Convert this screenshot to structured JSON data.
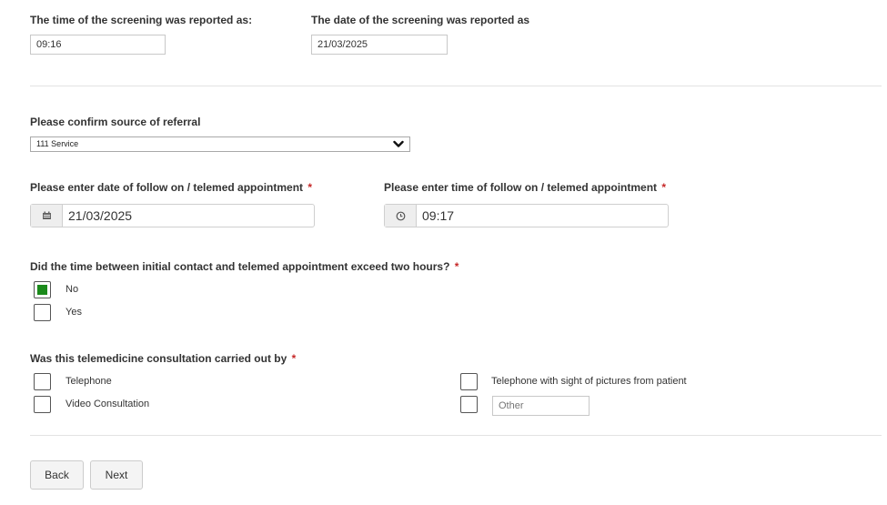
{
  "screening": {
    "time_label": "The time of the screening was reported as:",
    "time_value": "09:16",
    "date_label": "The date of the screening was reported as",
    "date_value": "21/03/2025"
  },
  "referral": {
    "label": "Please confirm source of referral",
    "selected": "111 Service"
  },
  "follow_on": {
    "date_label": "Please enter date of follow on / telemed appointment",
    "date_value": "21/03/2025",
    "time_label": "Please enter time of follow on / telemed appointment",
    "time_value": "09:17",
    "required_mark": "*"
  },
  "exceed_question": {
    "label": "Did the time between initial contact and telemed appointment exceed two hours?",
    "required_mark": "*",
    "options": [
      {
        "label": "No",
        "checked": true
      },
      {
        "label": "Yes",
        "checked": false
      }
    ]
  },
  "consultation": {
    "label": "Was this telemedicine consultation carried out by",
    "required_mark": "*",
    "options": [
      {
        "label": "Telephone",
        "checked": false
      },
      {
        "label": "Video Consultation",
        "checked": false
      },
      {
        "label": "Telephone with sight of pictures from patient",
        "checked": false
      }
    ],
    "other_placeholder": "Other"
  },
  "buttons": {
    "back": "Back",
    "next": "Next"
  },
  "colors": {
    "checked_fill": "#1b8a1b",
    "required": "#c62828"
  },
  "icons": {
    "calendar": "calendar-icon",
    "clock": "clock-icon",
    "dropdown": "chevron-down-icon"
  }
}
